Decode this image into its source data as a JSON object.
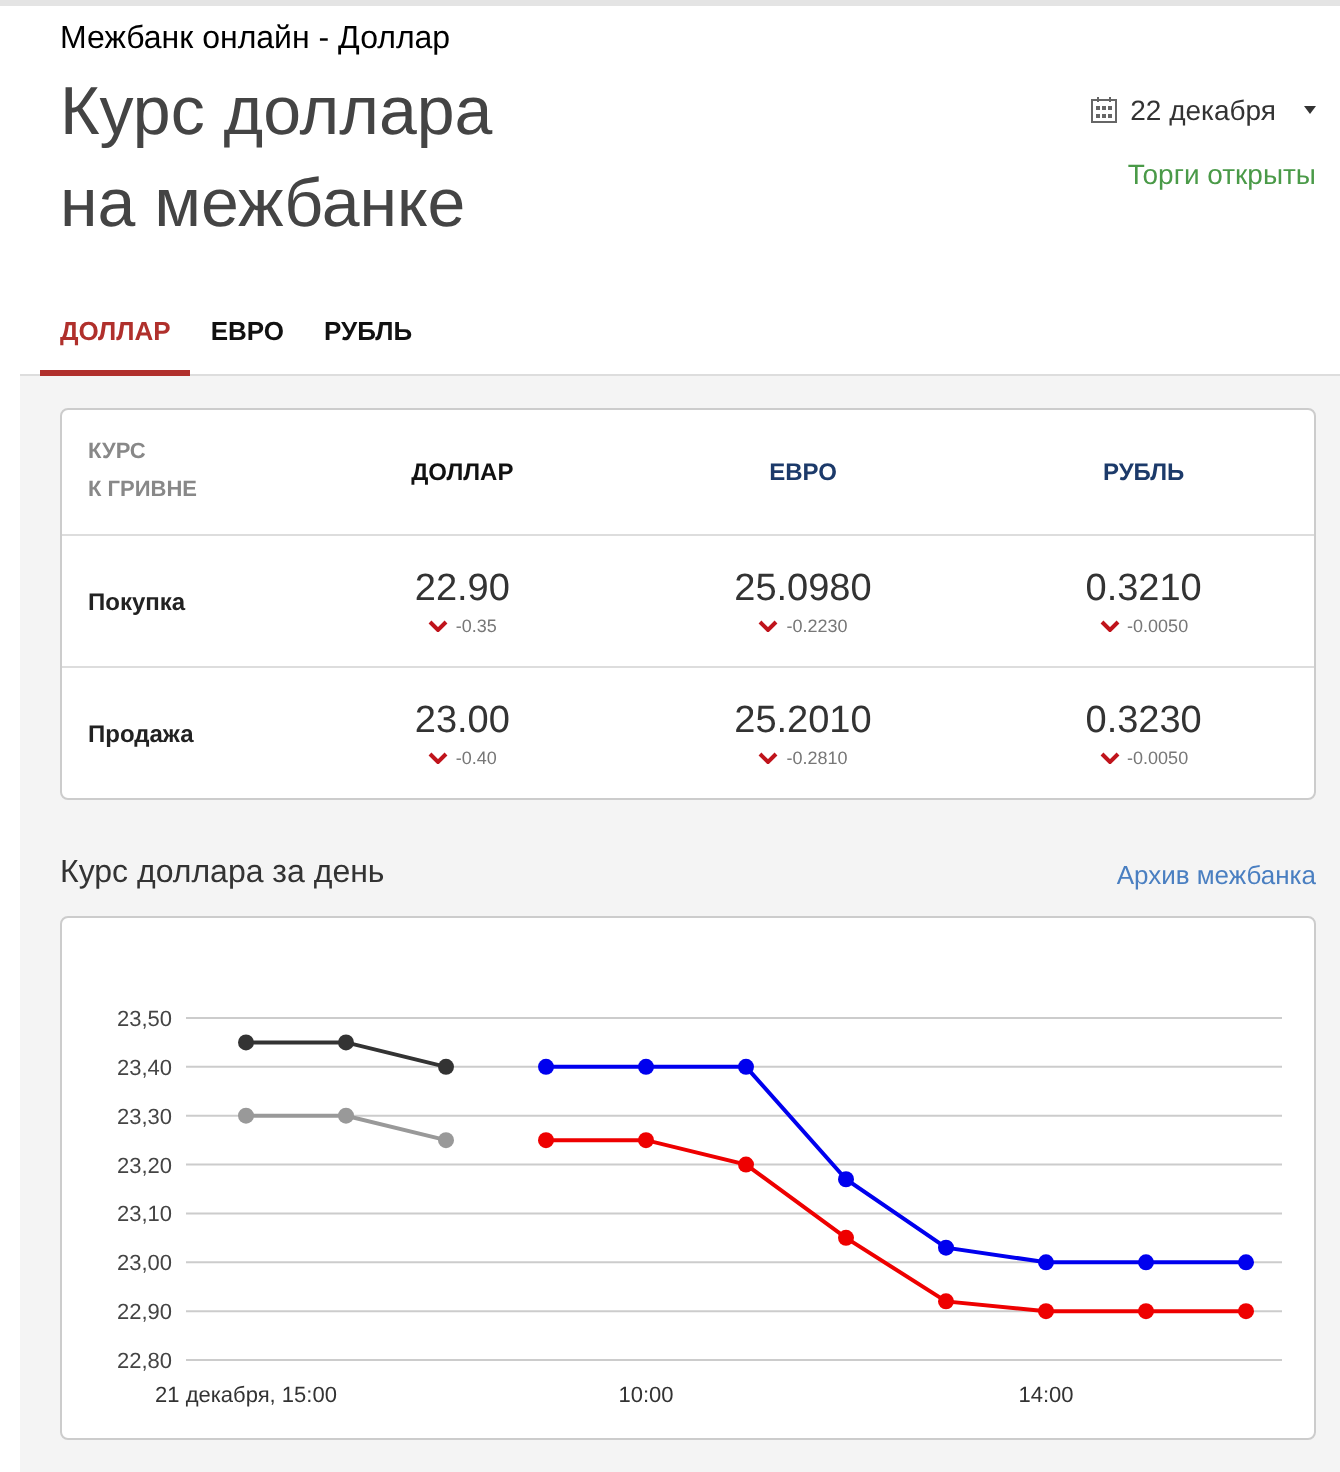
{
  "breadcrumb": "Межбанк онлайн - Доллар",
  "title_lines": [
    "Курс доллара",
    "на межбанке"
  ],
  "date_picker": {
    "value": "22 декабря"
  },
  "market_status": "Торги открыты",
  "tabs": [
    {
      "label": "ДОЛЛАР",
      "selected": true
    },
    {
      "label": "ЕВРО",
      "selected": false
    },
    {
      "label": "РУБЛЬ",
      "selected": false
    }
  ],
  "rates_table": {
    "corner_lines": [
      "КУРС",
      "К ГРИВНЕ"
    ],
    "columns": [
      "ДОЛЛАР",
      "ЕВРО",
      "РУБЛЬ"
    ],
    "rows": [
      {
        "label": "Покупка",
        "cells": [
          {
            "rate": "22.90",
            "change": "-0.35",
            "falling": true
          },
          {
            "rate": "25.0980",
            "change": "-0.2230",
            "falling": true
          },
          {
            "rate": "0.3210",
            "change": "-0.0050",
            "falling": true
          }
        ]
      },
      {
        "label": "Продажа",
        "cells": [
          {
            "rate": "23.00",
            "change": "-0.40",
            "falling": true
          },
          {
            "rate": "25.2010",
            "change": "-0.2810",
            "falling": true
          },
          {
            "rate": "0.3230",
            "change": "-0.0050",
            "falling": true
          }
        ]
      }
    ]
  },
  "day_chart": {
    "title": "Курс доллара за день",
    "archive_link": "Архив межбанка",
    "chart_data": {
      "type": "line",
      "categories": [
        "21 декабря, 15:00",
        null,
        null,
        null,
        "10:00",
        null,
        null,
        null,
        "14:00",
        null,
        null
      ],
      "ylim": [
        22.8,
        23.5
      ],
      "grid": true,
      "yticks": [
        {
          "value": 22.8,
          "label": "22,80"
        },
        {
          "value": 22.9,
          "label": "22,90"
        },
        {
          "value": 23.0,
          "label": "23,00"
        },
        {
          "value": 23.1,
          "label": "23,10"
        },
        {
          "value": 23.2,
          "label": "23,20"
        },
        {
          "value": 23.3,
          "label": "23,30"
        },
        {
          "value": 23.4,
          "label": "23,40"
        },
        {
          "value": 23.5,
          "label": "23,50"
        }
      ],
      "series": [
        {
          "color": "#333333",
          "marker": "circle",
          "values": [
            23.45,
            23.45,
            23.4,
            null,
            null,
            null,
            null,
            null,
            null,
            null,
            null
          ]
        },
        {
          "color": "#999999",
          "marker": "circle",
          "values": [
            23.3,
            23.3,
            23.25,
            null,
            null,
            null,
            null,
            null,
            null,
            null,
            null
          ]
        },
        {
          "color": "#0000ee",
          "marker": "circle",
          "values": [
            null,
            null,
            null,
            23.4,
            23.4,
            23.4,
            23.17,
            23.03,
            23.0,
            23.0,
            23.0
          ]
        },
        {
          "color": "#ee0000",
          "marker": "circle",
          "values": [
            null,
            null,
            null,
            23.25,
            23.25,
            23.2,
            23.05,
            22.92,
            22.9,
            22.9,
            22.9
          ]
        }
      ]
    }
  }
}
